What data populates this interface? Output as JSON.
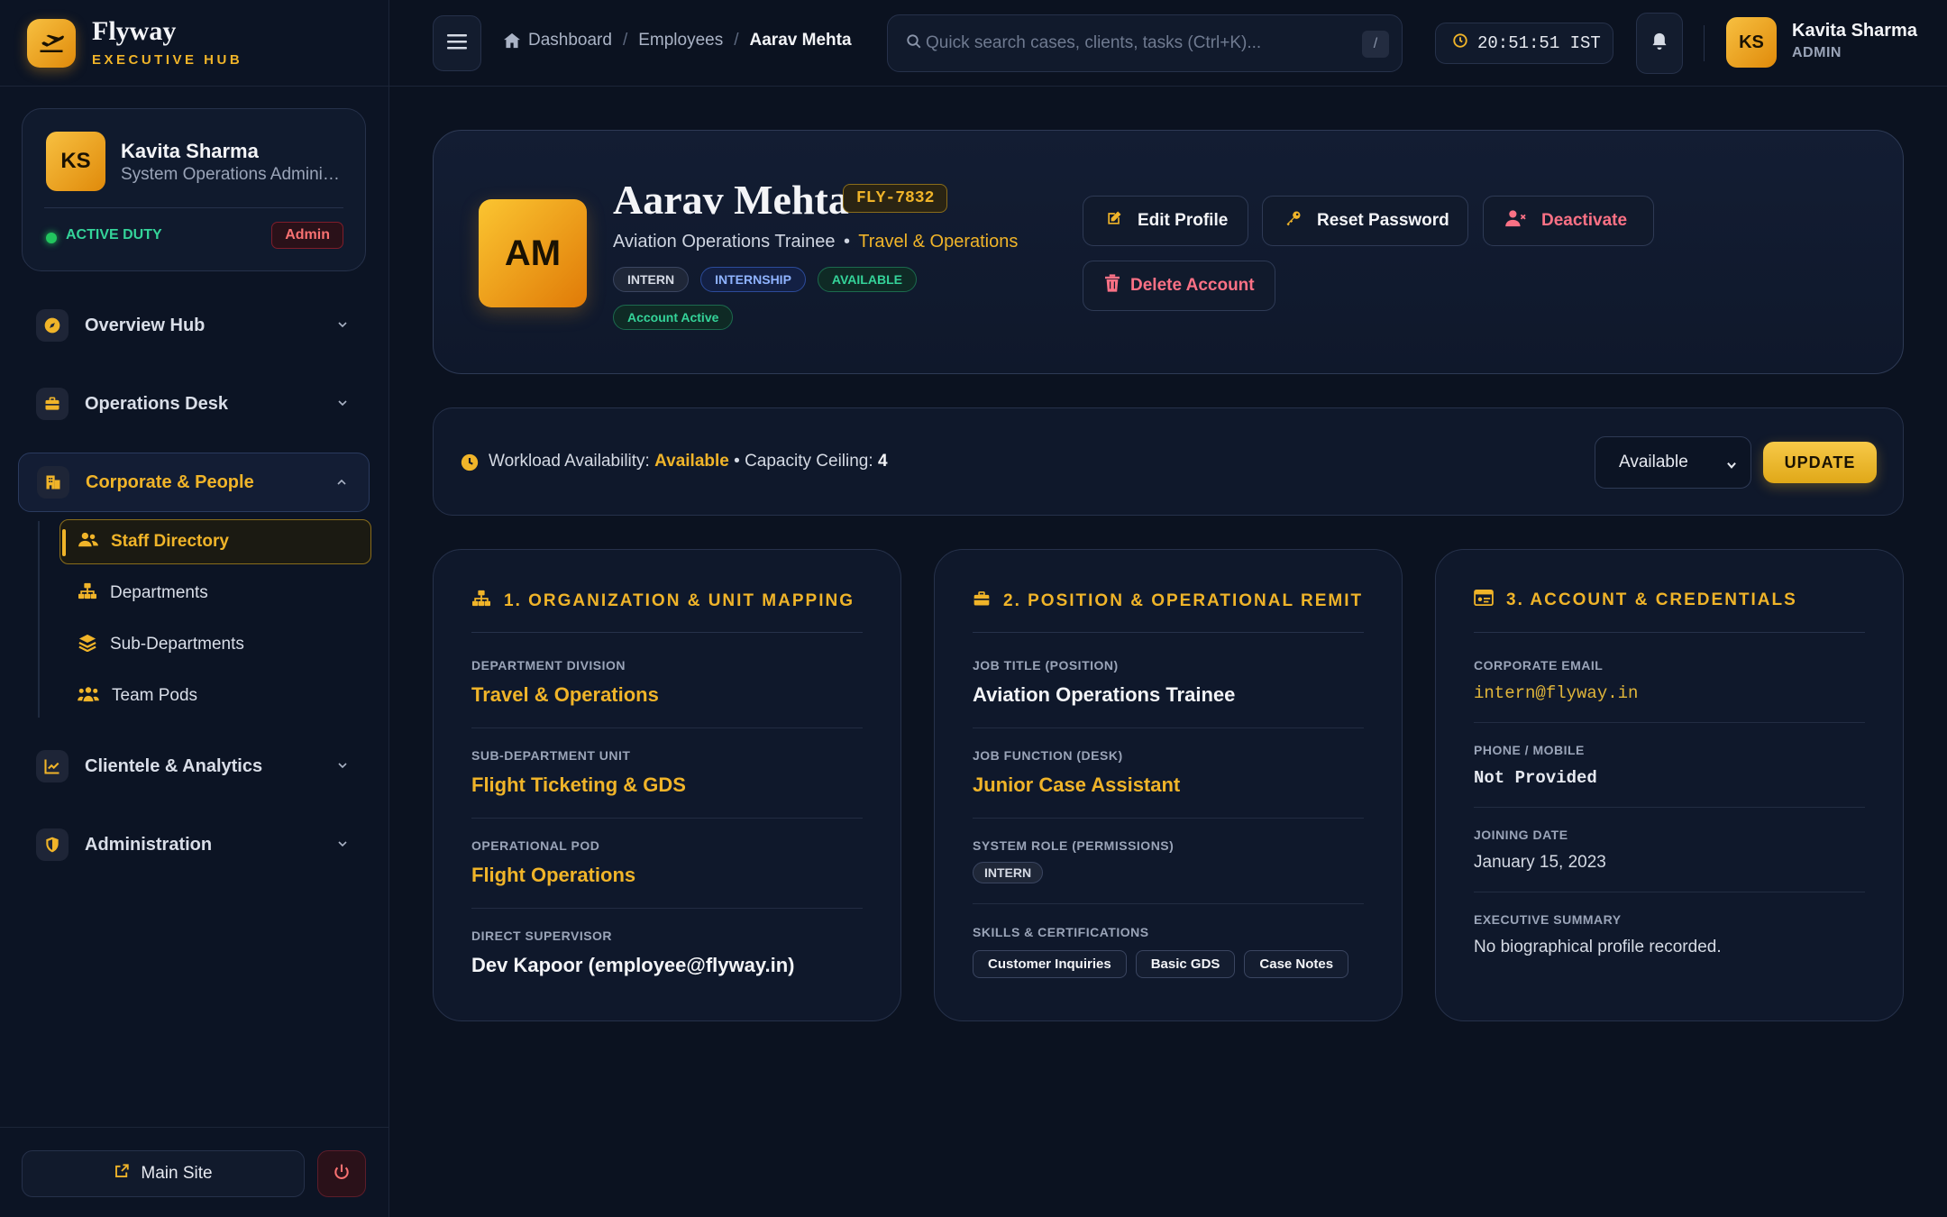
{
  "brand": {
    "name": "Flyway",
    "sub": "EXECUTIVE HUB"
  },
  "sidebar": {
    "profile": {
      "initials": "KS",
      "name": "Kavita Sharma",
      "role": "System Operations Admini…",
      "status": "ACTIVE DUTY",
      "badge": "Admin"
    },
    "nav": [
      {
        "label": "Overview Hub",
        "icon": "compass-icon"
      },
      {
        "label": "Operations Desk",
        "icon": "briefcase-icon"
      },
      {
        "label": "Corporate & People",
        "icon": "building-icon",
        "active": true
      },
      {
        "label": "Clientele & Analytics",
        "icon": "chart-line-icon"
      },
      {
        "label": "Administration",
        "icon": "shield-icon"
      }
    ],
    "subnav": [
      {
        "label": "Staff Directory",
        "icon": "users-icon",
        "active": true
      },
      {
        "label": "Departments",
        "icon": "sitemap-icon"
      },
      {
        "label": "Sub-Departments",
        "icon": "layers-icon"
      },
      {
        "label": "Team Pods",
        "icon": "people-group-icon"
      }
    ],
    "footer": {
      "main_site": "Main Site"
    }
  },
  "topbar": {
    "breadcrumb": [
      "Dashboard",
      "Employees",
      "Aarav Mehta"
    ],
    "search_placeholder": "Quick search cases, clients, tasks (Ctrl+K)...",
    "search_key": "/",
    "clock": "20:51:51 IST",
    "user": {
      "initials": "KS",
      "name": "Kavita Sharma",
      "role": "ADMIN"
    }
  },
  "employee": {
    "initials": "AM",
    "name": "Aarav Mehta",
    "code": "FLY-7832",
    "title": "Aviation Operations Trainee",
    "separator": "•",
    "department": "Travel & Operations",
    "pills": [
      "INTERN",
      "INTERNSHIP",
      "AVAILABLE"
    ],
    "account_status": "Account Active",
    "actions": {
      "edit": "Edit Profile",
      "reset": "Reset Password",
      "deactivate": "Deactivate",
      "delete": "Delete Account"
    }
  },
  "availability": {
    "label": "Workload Availability:",
    "value": "Available",
    "separator": "•",
    "capacity_label": "Capacity Ceiling:",
    "capacity": "4",
    "select_value": "Available",
    "update_label": "UPDATE"
  },
  "cards": {
    "org": {
      "title": "1. ORGANIZATION & UNIT MAPPING",
      "dept_label": "DEPARTMENT DIVISION",
      "dept": "Travel & Operations",
      "sub_label": "SUB-DEPARTMENT UNIT",
      "sub": "Flight Ticketing & GDS",
      "pod_label": "OPERATIONAL POD",
      "pod": "Flight Operations",
      "sup_label": "DIRECT SUPERVISOR",
      "sup": "Dev Kapoor (employee@flyway.in)"
    },
    "position": {
      "title": "2. POSITION & OPERATIONAL REMIT",
      "job_label": "JOB TITLE (POSITION)",
      "job": "Aviation Operations Trainee",
      "func_label": "JOB FUNCTION (DESK)",
      "func": "Junior Case Assistant",
      "role_label": "SYSTEM ROLE (PERMISSIONS)",
      "role": "INTERN",
      "skills_label": "SKILLS & CERTIFICATIONS",
      "skills": [
        "Customer Inquiries",
        "Basic GDS",
        "Case Notes"
      ]
    },
    "account": {
      "title": "3. ACCOUNT & CREDENTIALS",
      "email_label": "CORPORATE EMAIL",
      "email": "intern@flyway.in",
      "phone_label": "PHONE / MOBILE",
      "phone": "Not Provided",
      "join_label": "JOINING DATE",
      "join": "January 15, 2023",
      "summary_label": "EXECUTIVE SUMMARY",
      "summary": "No biographical profile recorded."
    }
  },
  "colors": {
    "accent": "#f0b429",
    "danger": "#fb7185",
    "success": "#34d399",
    "bg": "#0b1220"
  }
}
